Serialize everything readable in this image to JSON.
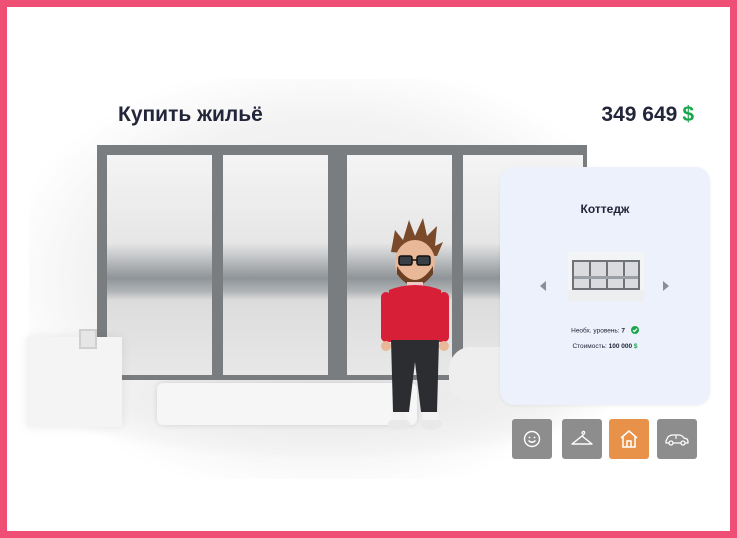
{
  "header": {
    "title": "Купить жильё",
    "balance": "349 649",
    "currency": "$"
  },
  "house_card": {
    "name": "Коттедж",
    "required_level_label": "Необх. уровень:",
    "required_level_value": "7",
    "cost_label": "Стоимость:",
    "cost_value": "100 000",
    "cost_currency": "$"
  },
  "tabs": [
    {
      "icon": "smiley-icon",
      "active": false
    },
    {
      "icon": "hanger-icon",
      "active": false
    },
    {
      "icon": "house-icon",
      "active": true
    },
    {
      "icon": "car-icon",
      "active": false
    }
  ],
  "colors": {
    "frame_border": "#ef4f74",
    "money_green": "#19a54b",
    "active_tab": "#e89148",
    "inactive_tab": "#8d8d8d",
    "card_background": "#edf1fb",
    "title_text": "#23253a"
  }
}
